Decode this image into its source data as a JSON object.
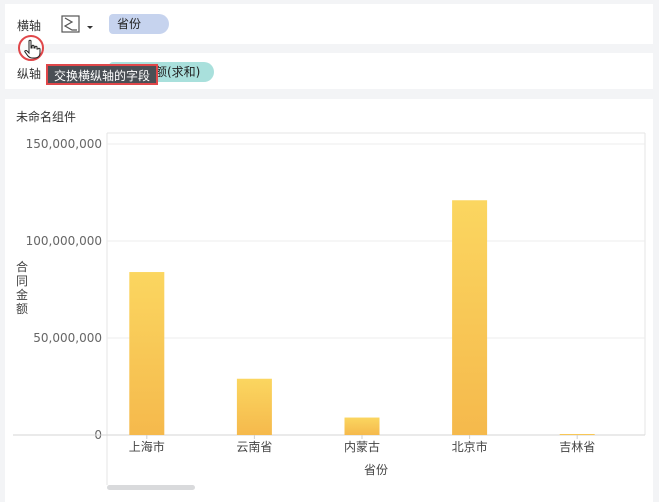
{
  "axis_config": {
    "x_axis": {
      "label": "横轴",
      "field": "省份"
    },
    "y_axis": {
      "label": "纵轴",
      "field": "额(求和)"
    },
    "chart_type_icon": "chart-type-icon"
  },
  "tooltip": {
    "text": "交换横纵轴的字段"
  },
  "component": {
    "title": "未命名组件"
  },
  "chart_data": {
    "type": "bar",
    "categories": [
      "上海市",
      "云南省",
      "内蒙古",
      "北京市",
      "吉林省"
    ],
    "values": [
      84000000,
      29000000,
      9000000,
      121000000,
      500000
    ],
    "xlabel": "省份",
    "ylabel": "合同金额",
    "ylim": [
      0,
      150000000
    ],
    "yticks": [
      {
        "value": 0,
        "label": "0"
      },
      {
        "value": 50000000,
        "label": "50,000,000"
      },
      {
        "value": 100000000,
        "label": "100,000,000"
      },
      {
        "value": 150000000,
        "label": "150,000,000"
      }
    ],
    "grid": true,
    "bar_color_top": "#fbd660",
    "bar_color_bottom": "#f5b94c"
  }
}
